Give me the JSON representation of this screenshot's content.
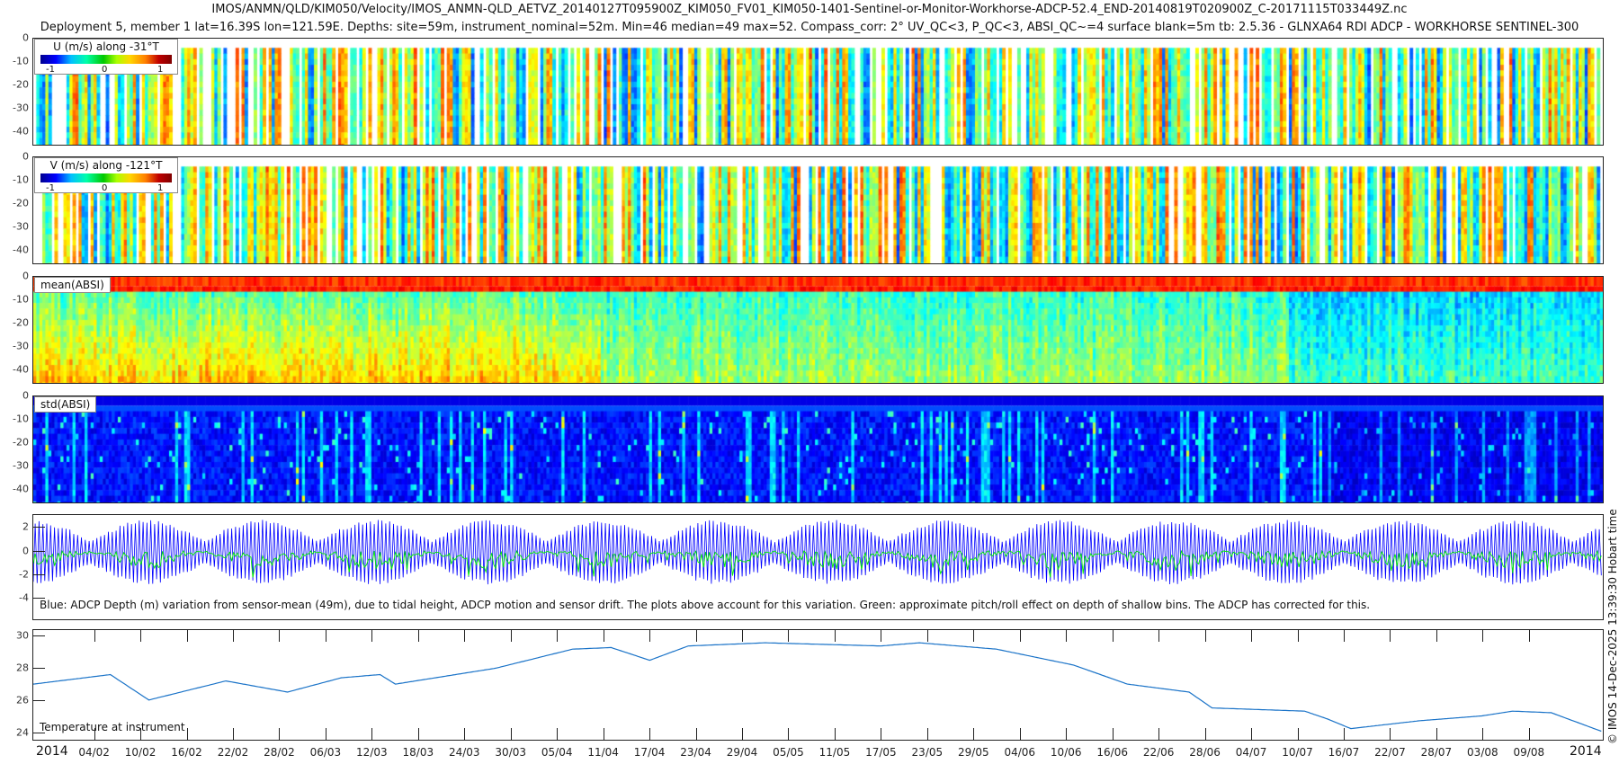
{
  "title_line1": "IMOS/ANMN/QLD/KIM050/Velocity/IMOS_ANMN-QLD_AETVZ_20140127T095900Z_KIM050_FV01_KIM050-1401-Sentinel-or-Monitor-Workhorse-ADCP-52.4_END-20140819T020900Z_C-20171115T033449Z.nc",
  "title_line2": "Deployment 5, member 1 lat=16.39S lon=121.59E. Depths: site=59m, instrument_nominal=52m. Min=46 median=49 max=52. Compass_corr: 2° UV_QC<3, P_QC<3, ABSI_QC~=4 surface blank=5m tb: 2.5.36 - GLNXA64 RDI ADCP - WORKHORSE SENTINEL-300",
  "side_text": "© IMOS 14-Dec-2025 13:39:30 Hobart time",
  "colors": {
    "depth_line": "#0000ff",
    "pitch_roll": "#00ee00",
    "temperature": "#1a73c8"
  },
  "chart_data": [
    {
      "type": "heatmap",
      "name": "u",
      "legend": "U (m/s) along -31°T",
      "colorbar_ticks": [
        "-1",
        "0",
        "1"
      ],
      "clim": [
        -1.2,
        1.2
      ],
      "ylim": [
        -46,
        0
      ],
      "yticks": [
        "0",
        "-10",
        "-20",
        "-30",
        "-40"
      ],
      "typical_value": 0.0,
      "spread": 0.45,
      "gappy": true
    },
    {
      "type": "heatmap",
      "name": "v",
      "legend": "V (m/s) along -121°T",
      "colorbar_ticks": [
        "-1",
        "0",
        "1"
      ],
      "clim": [
        -1.2,
        1.2
      ],
      "ylim": [
        -46,
        0
      ],
      "yticks": [
        "0",
        "-10",
        "-20",
        "-30",
        "-40"
      ],
      "typical_value": 0.0,
      "spread": 0.45,
      "gappy": true
    },
    {
      "type": "heatmap",
      "name": "mean_absi",
      "legend": "mean(ABSI)",
      "ylim": [
        -46,
        0
      ],
      "yticks": [
        "0",
        "-10",
        "-20",
        "-30",
        "-40"
      ],
      "gappy": false
    },
    {
      "type": "heatmap",
      "name": "std_absi",
      "legend": "std(ABSI)",
      "ylim": [
        -46,
        0
      ],
      "yticks": [
        "0",
        "-10",
        "-20",
        "-30",
        "-40"
      ],
      "gappy": false
    },
    {
      "type": "line",
      "name": "depth_variation",
      "ylim": [
        -5.9,
        3.1
      ],
      "yticks": [
        "2",
        "0",
        "-2",
        "-4"
      ],
      "tidal_amplitude_max": 2.8,
      "pitch_roll_min": -3.2,
      "caption": "Blue: ADCP Depth (m) variation from sensor-mean (49m), due to tidal height, ADCP motion and sensor drift. The plots above account for this variation. Green: approximate pitch/roll effect on depth of shallow bins. The ADCP has corrected for this."
    },
    {
      "type": "line",
      "name": "temperature",
      "ylim": [
        23.5,
        30.4
      ],
      "yticks": [
        "30",
        "28",
        "26",
        "24"
      ],
      "label": "Temperature at instrument",
      "x_days": [
        0,
        10,
        15,
        25,
        33,
        40,
        45,
        47,
        60,
        70,
        75,
        80,
        85,
        95,
        110,
        115,
        125,
        135,
        142,
        150,
        153,
        165,
        168,
        171,
        180,
        188,
        192,
        197,
        203.7
      ],
      "y": [
        27.0,
        27.6,
        26.0,
        27.2,
        26.5,
        27.4,
        27.6,
        27.0,
        28.0,
        29.2,
        29.3,
        28.5,
        29.4,
        29.6,
        29.4,
        29.6,
        29.2,
        28.2,
        27.0,
        26.5,
        25.5,
        25.3,
        24.8,
        24.2,
        24.7,
        25.0,
        25.3,
        25.2,
        24.0
      ]
    }
  ],
  "x_axis": {
    "start": "2014-01-27 09:59",
    "end": "2014-08-19 02:09",
    "span_days": 203.7,
    "year_left": "2014",
    "year_right": "2014",
    "first_tick_day": 8,
    "tick_step_days": 6,
    "tick_labels": [
      "04/02",
      "10/02",
      "16/02",
      "22/02",
      "28/02",
      "06/03",
      "12/03",
      "18/03",
      "24/03",
      "30/03",
      "05/04",
      "11/04",
      "17/04",
      "23/04",
      "29/04",
      "05/05",
      "11/05",
      "17/05",
      "23/05",
      "29/05",
      "04/06",
      "10/06",
      "16/06",
      "22/06",
      "28/06",
      "04/07",
      "10/07",
      "16/07",
      "22/07",
      "28/07",
      "03/08",
      "09/08"
    ]
  }
}
